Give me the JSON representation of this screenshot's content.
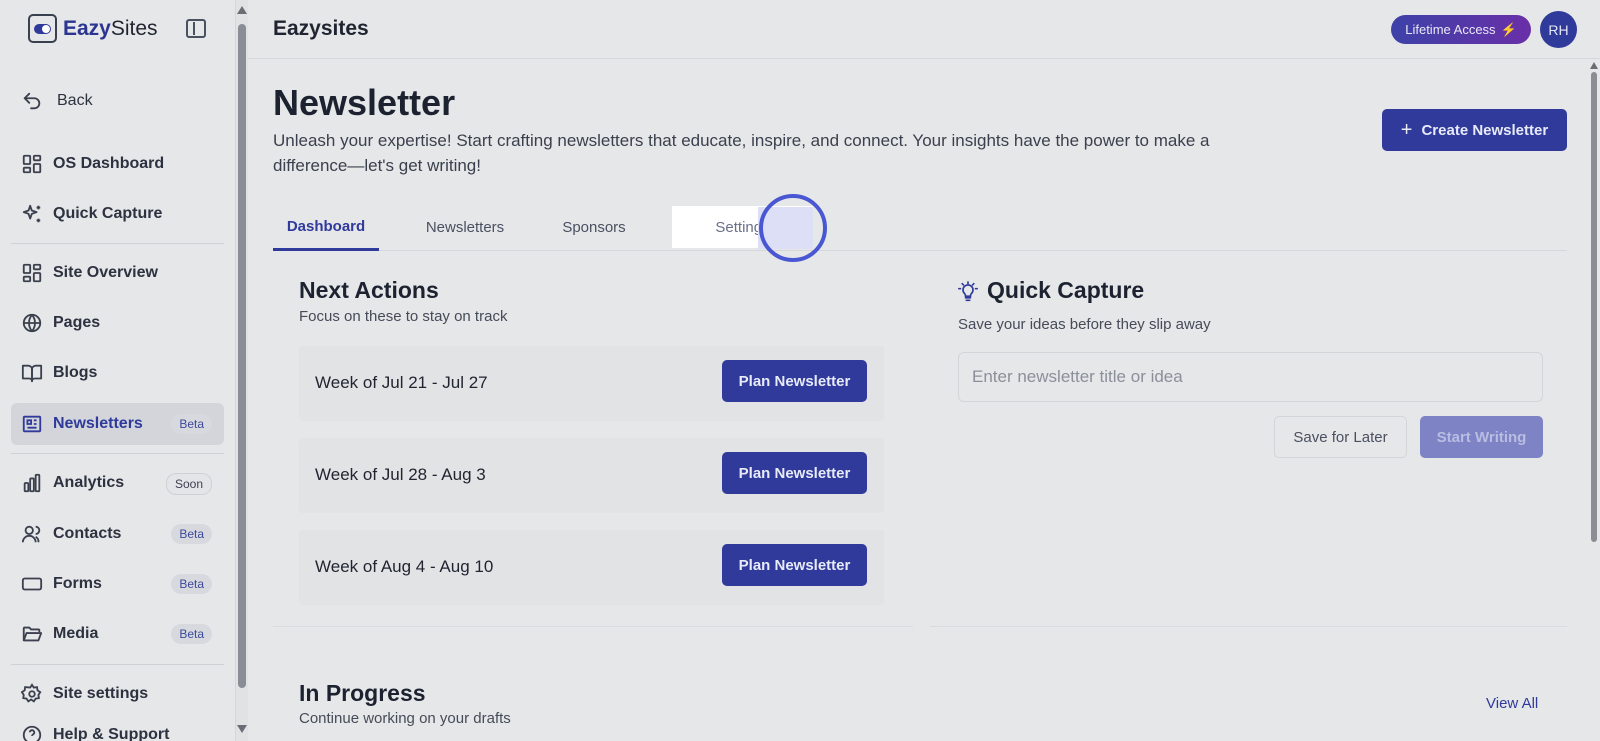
{
  "sidebar": {
    "logo": {
      "brand_bold": "Eazy",
      "brand_rest": "Sites"
    },
    "items": [
      {
        "label": "Back",
        "icon": "undo-arrow-icon"
      },
      {
        "label": "OS Dashboard",
        "icon": "dashboard-grid-icon"
      },
      {
        "label": "Quick Capture",
        "icon": "sparkles-icon"
      },
      {
        "label": "Site Overview",
        "icon": "dashboard-grid-icon"
      },
      {
        "label": "Pages",
        "icon": "globe-icon"
      },
      {
        "label": "Blogs",
        "icon": "book-open-icon"
      },
      {
        "label": "Newsletters",
        "icon": "newspaper-icon",
        "badge": "Beta",
        "active": true
      },
      {
        "label": "Analytics",
        "icon": "bar-chart-icon",
        "badge": "Soon"
      },
      {
        "label": "Contacts",
        "icon": "users-icon",
        "badge": "Beta"
      },
      {
        "label": "Forms",
        "icon": "form-input-icon",
        "badge": "Beta"
      },
      {
        "label": "Media",
        "icon": "folder-open-icon",
        "badge": "Beta"
      },
      {
        "label": "Site settings",
        "icon": "gear-icon"
      },
      {
        "label": "Help & Support",
        "icon": "help-circle-icon"
      }
    ]
  },
  "topbar": {
    "title": "Eazysites",
    "lifetime_label": "Lifetime Access",
    "avatar_initials": "RH"
  },
  "page": {
    "title": "Newsletter",
    "description": "Unleash your expertise! Start crafting newsletters that educate, inspire, and connect. Your insights have the power to make a difference—let's get writing!",
    "create_button": "Create Newsletter"
  },
  "tabs": [
    "Dashboard",
    "Newsletters",
    "Sponsors",
    "Settings"
  ],
  "next_actions": {
    "title": "Next Actions",
    "subtitle": "Focus on these to stay on track",
    "weeks": [
      {
        "label": "Week of Jul 21 - Jul 27",
        "button": "Plan Newsletter"
      },
      {
        "label": "Week of Jul 28 - Aug 3",
        "button": "Plan Newsletter"
      },
      {
        "label": "Week of Aug 4 - Aug 10",
        "button": "Plan Newsletter"
      }
    ]
  },
  "quick_capture": {
    "title": "Quick Capture",
    "subtitle": "Save your ideas before they slip away",
    "placeholder": "Enter newsletter title or idea",
    "save_later": "Save for Later",
    "start_writing": "Start Writing"
  },
  "in_progress": {
    "title": "In Progress",
    "subtitle": "Continue working on your drafts",
    "view_all": "View All"
  },
  "colors": {
    "accent": "#2f3a9b",
    "background": "#e6e7e9"
  }
}
